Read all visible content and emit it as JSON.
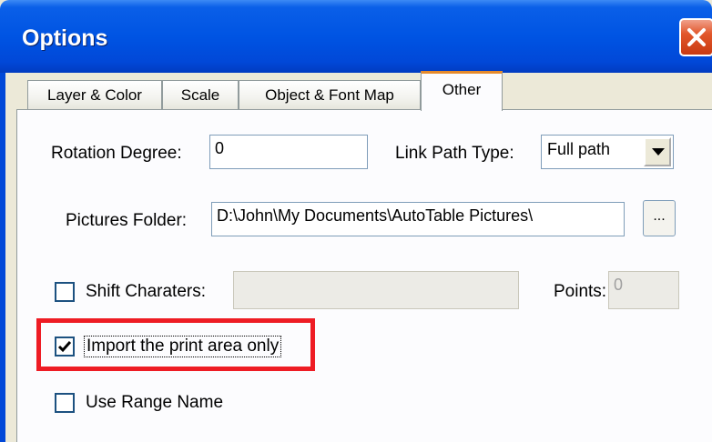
{
  "window": {
    "title": "Options"
  },
  "tabs": [
    {
      "label": "Layer & Color",
      "active": false
    },
    {
      "label": "Scale",
      "active": false
    },
    {
      "label": "Object & Font Map",
      "active": false
    },
    {
      "label": "Other",
      "active": true
    }
  ],
  "form": {
    "rotation_degree": {
      "label": "Rotation Degree:",
      "value": "0"
    },
    "link_path_type": {
      "label": "Link Path Type:",
      "value": "Full path"
    },
    "pictures_folder": {
      "label": "Pictures Folder:",
      "value": "D:\\John\\My Documents\\AutoTable Pictures\\",
      "browse_label": "..."
    },
    "shift_characters": {
      "label": "Shift Charaters:",
      "checked": false,
      "value": ""
    },
    "points": {
      "label": "Points:",
      "value": "0"
    },
    "import_print_area": {
      "label": "Import the print area only",
      "checked": true
    },
    "use_range_name": {
      "label": "Use Range Name",
      "checked": false
    }
  },
  "annotation": {
    "color": "#ee1c24"
  },
  "icons": {
    "close": "close-icon",
    "dropdown": "chevron-down-icon",
    "check": "checkmark-icon"
  }
}
